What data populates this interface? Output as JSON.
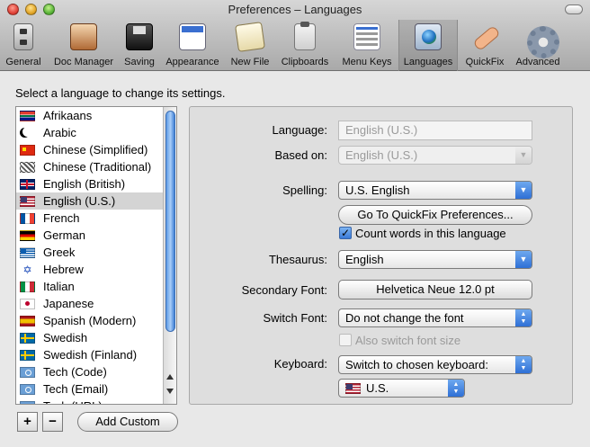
{
  "window": {
    "title": "Preferences – Languages"
  },
  "toolbar": {
    "items": [
      {
        "label": "General",
        "icon": "general-icon"
      },
      {
        "label": "Doc Manager",
        "icon": "doc-manager-icon"
      },
      {
        "label": "Saving",
        "icon": "floppy-disk-icon"
      },
      {
        "label": "Appearance",
        "icon": "appearance-icon"
      },
      {
        "label": "New File",
        "icon": "new-file-icon"
      },
      {
        "label": "Clipboards",
        "icon": "clipboard-icon"
      },
      {
        "label": "Menu Keys",
        "icon": "menu-keys-icon"
      },
      {
        "label": "Languages",
        "icon": "globe-flag-icon",
        "selected": true
      },
      {
        "label": "QuickFix",
        "icon": "bandage-icon"
      },
      {
        "label": "Advanced",
        "icon": "gear-icon"
      }
    ]
  },
  "instruction": "Select a language to change its settings.",
  "languages": [
    {
      "name": "Afrikaans",
      "flag": "za"
    },
    {
      "name": "Arabic",
      "flag": "ar"
    },
    {
      "name": "Chinese (Simplified)",
      "flag": "cn"
    },
    {
      "name": "Chinese (Traditional)",
      "flag": "tw"
    },
    {
      "name": "English (British)",
      "flag": "gb"
    },
    {
      "name": "English (U.S.)",
      "flag": "us",
      "selected": true
    },
    {
      "name": "French",
      "flag": "fr"
    },
    {
      "name": "German",
      "flag": "de"
    },
    {
      "name": "Greek",
      "flag": "gr"
    },
    {
      "name": "Hebrew",
      "flag": "il"
    },
    {
      "name": "Italian",
      "flag": "it"
    },
    {
      "name": "Japanese",
      "flag": "jp"
    },
    {
      "name": "Spanish (Modern)",
      "flag": "es"
    },
    {
      "name": "Swedish",
      "flag": "se"
    },
    {
      "name": "Swedish (Finland)",
      "flag": "se"
    },
    {
      "name": "Tech (Code)",
      "flag": "un"
    },
    {
      "name": "Tech (Email)",
      "flag": "un"
    },
    {
      "name": "Tech (URL)",
      "flag": "un"
    }
  ],
  "list_buttons": {
    "add": "+",
    "remove": "−",
    "add_custom": "Add Custom"
  },
  "settings": {
    "language_label": "Language:",
    "language_value": "English (U.S.)",
    "based_on_label": "Based on:",
    "based_on_value": "English (U.S.)",
    "spelling_label": "Spelling:",
    "spelling_value": "U.S. English",
    "quickfix_button": "Go To QuickFix Preferences...",
    "count_words_label": "Count words in this language",
    "count_words_checked": true,
    "thesaurus_label": "Thesaurus:",
    "thesaurus_value": "English",
    "secondary_font_label": "Secondary Font:",
    "secondary_font_value": "Helvetica Neue 12.0 pt",
    "switch_font_label": "Switch Font:",
    "switch_font_value": "Do not change the font",
    "also_switch_size_label": "Also switch font size",
    "also_switch_size_checked": false,
    "keyboard_label": "Keyboard:",
    "keyboard_value": "Switch to chosen keyboard:",
    "keyboard_layout_value": "U.S."
  },
  "colors": {
    "accent": "#3a7ad8",
    "selection": "#d4d4d4",
    "disabled_text": "#9a9a9a"
  }
}
